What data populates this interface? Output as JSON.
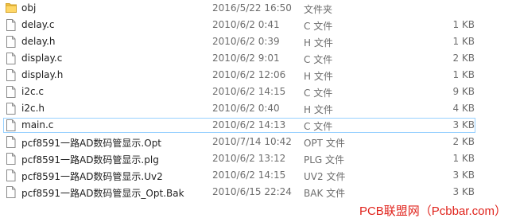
{
  "files": [
    {
      "name": "obj",
      "modified": "2016/5/22 16:50",
      "type": "文件夹",
      "size": "",
      "icon": "folder-icon"
    },
    {
      "name": "delay.c",
      "modified": "2010/6/2 0:41",
      "type": "C 文件",
      "size": "1 KB",
      "icon": "file-icon"
    },
    {
      "name": "delay.h",
      "modified": "2010/6/2 0:39",
      "type": "H 文件",
      "size": "1 KB",
      "icon": "file-icon"
    },
    {
      "name": "display.c",
      "modified": "2010/6/2 9:01",
      "type": "C 文件",
      "size": "2 KB",
      "icon": "file-icon"
    },
    {
      "name": "display.h",
      "modified": "2010/6/2 12:06",
      "type": "H 文件",
      "size": "1 KB",
      "icon": "file-icon"
    },
    {
      "name": "i2c.c",
      "modified": "2010/6/2 14:15",
      "type": "C 文件",
      "size": "9 KB",
      "icon": "file-icon"
    },
    {
      "name": "i2c.h",
      "modified": "2010/6/2 0:40",
      "type": "H 文件",
      "size": "4 KB",
      "icon": "file-icon"
    },
    {
      "name": "main.c",
      "modified": "2010/6/2 14:13",
      "type": "C 文件",
      "size": "3 KB",
      "icon": "file-icon",
      "selected": true
    },
    {
      "name": "pcf8591一路AD数码管显示.Opt",
      "modified": "2010/7/14 10:42",
      "type": "OPT 文件",
      "size": "2 KB",
      "icon": "file-icon"
    },
    {
      "name": "pcf8591一路AD数码管显示.plg",
      "modified": "2010/6/2 13:12",
      "type": "PLG 文件",
      "size": "1 KB",
      "icon": "file-icon"
    },
    {
      "name": "pcf8591一路AD数码管显示.Uv2",
      "modified": "2010/6/2 14:15",
      "type": "UV2 文件",
      "size": "3 KB",
      "icon": "file-icon"
    },
    {
      "name": "pcf8591一路AD数码管显示_Opt.Bak",
      "modified": "2010/6/15 22:24",
      "type": "BAK 文件",
      "size": "3 KB",
      "icon": "file-icon"
    }
  ],
  "watermark": "PCB联盟网（Pcbbar.com）",
  "colors": {
    "folder": "#f0c246",
    "selection_border": "#99d1ff",
    "watermark": "#e0231c"
  }
}
